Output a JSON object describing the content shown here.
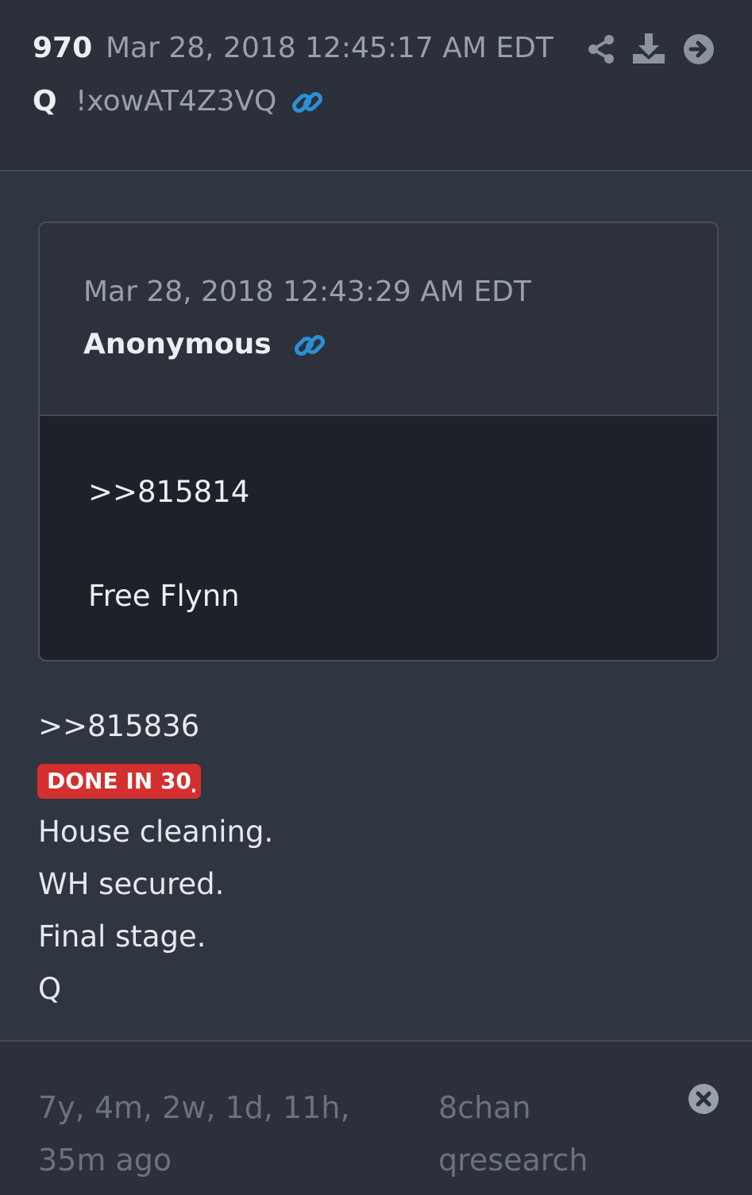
{
  "post": {
    "number": "970",
    "date": "Mar 28, 2018 12:45:17 AM EDT",
    "author": "Q",
    "tripcode": "!xowAT4Z3VQ"
  },
  "header_icons": [
    "share-icon",
    "download-icon",
    "arrow-right-icon",
    "link-icon"
  ],
  "quoted": {
    "date": "Mar 28, 2018 12:43:29 AM EDT",
    "author": "Anonymous",
    "ref": ">>815814",
    "text": "Free Flynn"
  },
  "body": {
    "ref": ">>815836",
    "badge": "DONE IN 30",
    "badge_color": "#d32f2f",
    "badge_suffix": ".",
    "lines": [
      "House cleaning.",
      "WH secured.",
      "Final stage.",
      "Q"
    ]
  },
  "footer": {
    "elapsed": "7y, 4m, 2w, 1d, 11h, 35m ago",
    "source": "8chan qresearch"
  },
  "colors": {
    "accent_link": "#2c8fd6",
    "background": "#2f3541"
  }
}
